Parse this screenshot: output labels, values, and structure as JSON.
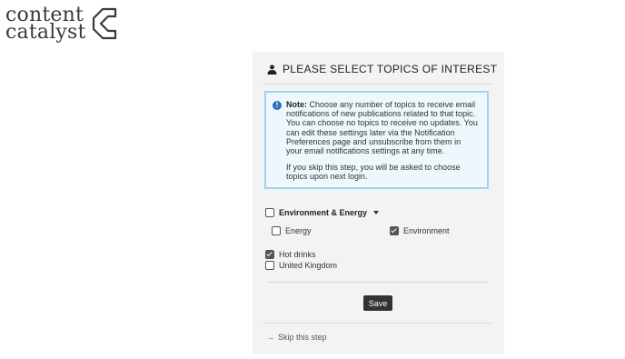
{
  "logo": {
    "line1": "content",
    "line2": "catalyst",
    "mark_icon": "c-chevron-logo-mark"
  },
  "header": {
    "icon": "user-icon",
    "title": "PLEASE SELECT TOPICS OF INTEREST"
  },
  "note": {
    "icon": "info-icon",
    "label": "Note:",
    "text": "Choose any number of topics to receive email notifications of new publications related to that topic. You can choose no topics to receive no updates. You can edit these settings later via the Notification Preferences page and unsubscribe from them in your email notifications settings at any time.",
    "skip_text": "If you skip this step, you will be asked to choose topics upon next login."
  },
  "topics": {
    "group": {
      "label": "Environment & Energy",
      "checked": false
    },
    "children": [
      {
        "label": "Energy",
        "checked": false
      },
      {
        "label": "Environment",
        "checked": true
      }
    ],
    "others": [
      {
        "label": "Hot drinks",
        "checked": true
      },
      {
        "label": "United Kingdom",
        "checked": false
      }
    ]
  },
  "save_label": "Save",
  "skip": {
    "icon": "arrow-right-icon",
    "label": "Skip this step"
  },
  "colors": {
    "note_border": "#9fd4ee",
    "note_bg": "#eef7fc",
    "info_icon": "#2a6fb7",
    "button": "#333333",
    "panel_bg": "#f3f3f3"
  }
}
